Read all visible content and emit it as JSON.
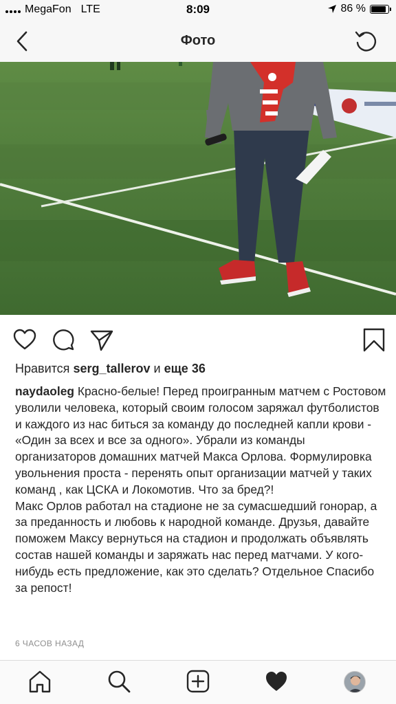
{
  "status_bar": {
    "carrier": "MegaFon",
    "network": "LTE",
    "time": "8:09",
    "battery": "86 %",
    "battery_level": 0.86,
    "icons": [
      "signal-icon",
      "location-arrow-icon",
      "battery-icon"
    ]
  },
  "nav": {
    "title": "Фото",
    "back_icon": "chevron-left-icon",
    "refresh_icon": "refresh-icon"
  },
  "actions": {
    "icons": [
      "heart-icon",
      "comment-icon",
      "share-icon",
      "bookmark-icon"
    ]
  },
  "likes": {
    "prefix": "Нравится",
    "user": "serg_tallerov",
    "middle": "и",
    "more": "еще 36"
  },
  "post": {
    "username": "naydaoleg",
    "paragraph_1": "Красно-белые! Перед проигранным матчем с Ростовом уволили человека, который своим голосом заряжал футболистов и каждого из нас биться за команду до последней капли крови - «Один за всех и все за одного». Убрали из команды организаторов домашних матчей Макса Орлова. Формулировка увольнения проста - перенять опыт организации матчей у таких команд , как ЦСКА и Локомотив. Что за бред?!",
    "paragraph_2": "Макс Орлов работал на стадионе не за сумасшедший гонорар, а за преданность и любовь к народной команде. Друзья, давайте поможем Максу вернуться на стадион и продолжать объявлять состав нашей команды и заряжать нас перед матчами. У кого-нибудь есть предложение, как это сделать? Отдельное Спасибо за репост!",
    "timestamp": "6 ЧАСОВ НАЗАД"
  },
  "tab_bar": {
    "icons": [
      "home-icon",
      "search-icon",
      "new-post-icon",
      "activity-heart-icon",
      "profile-avatar"
    ]
  },
  "colors": {
    "bar_background": "#f7f7f7",
    "text": "#262626",
    "muted": "#8e8e8e",
    "grass": "#4f7a3c",
    "sneakers": "#c62a2a"
  }
}
